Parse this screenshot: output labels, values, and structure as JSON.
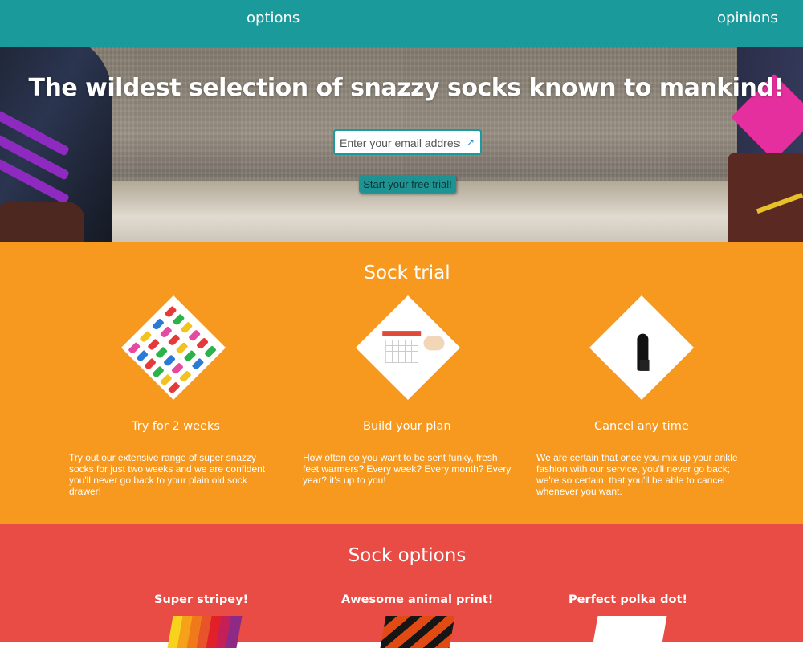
{
  "nav": {
    "items": [
      {
        "label": "options"
      },
      {
        "label": "opinions"
      }
    ]
  },
  "hero": {
    "headline": "The wildest selection of snazzy socks known to mankind!",
    "email_placeholder": "Enter your email address",
    "cta_label": "Start your free trial!"
  },
  "trial": {
    "title": "Sock trial",
    "features": [
      {
        "title": "Try for 2 weeks",
        "text": "Try out our extensive range of super snazzy socks for just two weeks and we are confident you'll never go back to your plain old sock drawer!",
        "icon": "socks-pattern-image"
      },
      {
        "title": "Build your plan",
        "text": "How often do you want to be sent funky, fresh feet warmers? Every week? Every month? Every year? it's up to you!",
        "icon": "calendar-image"
      },
      {
        "title": "Cancel any time",
        "text": "We are certain that once you mix up your ankle fashion with our service, you'll never go back; we're so certain, that you'll be able to cancel whenever you want.",
        "icon": "traveler-sunset-image"
      }
    ]
  },
  "options": {
    "title": "Sock options",
    "items": [
      {
        "title": "Super stripey!",
        "image": "stripes-swatch"
      },
      {
        "title": "Awesome animal print!",
        "image": "animal-print-swatch"
      },
      {
        "title": "Perfect polka dot!",
        "image": "polka-dot-swatch"
      }
    ]
  },
  "colors": {
    "nav": "#1a9a9a",
    "trial_bg": "#f6991e",
    "options_bg": "#e84c45",
    "text": "#ffffff"
  }
}
